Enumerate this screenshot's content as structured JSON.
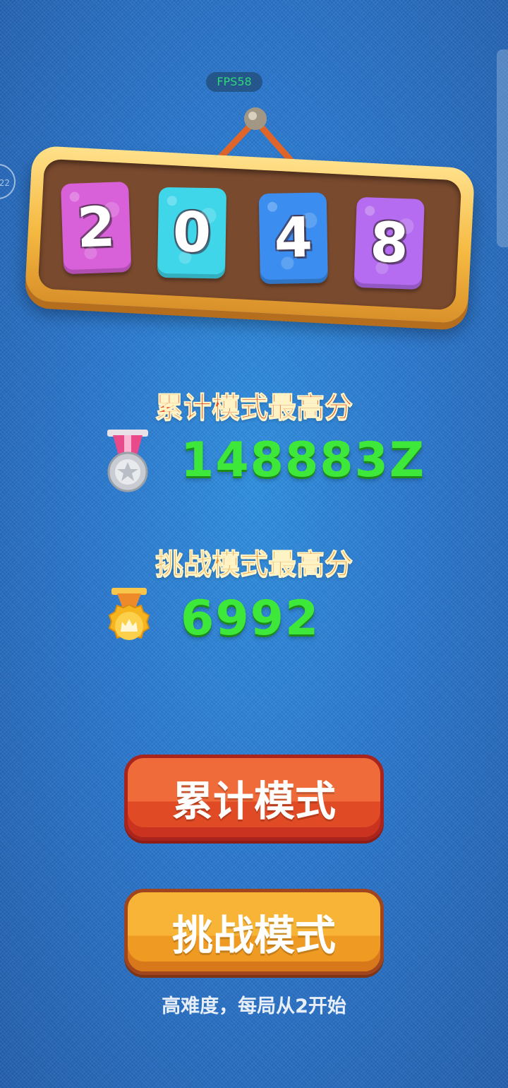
{
  "hud": {
    "fps": "FPS58",
    "side_bubble": "22"
  },
  "logo": {
    "tiles": [
      "2",
      "0",
      "4",
      "8"
    ]
  },
  "cumulative": {
    "label": "累计模式最高分",
    "score": "148883Z"
  },
  "challenge": {
    "label": "挑战模式最高分",
    "score": "6992"
  },
  "buttons": {
    "cumulative": "累计模式",
    "challenge": "挑战模式"
  },
  "hint": "高难度，每局从2开始",
  "colors": {
    "background": "#2a78cf",
    "score_green": "#3ee83a",
    "label_red": "#e0441f",
    "label_orange": "#e6892a",
    "tile_pink": "#d860d8",
    "tile_cyan": "#3fd6ea",
    "tile_blue": "#3b8ef0",
    "tile_purple": "#b56cf0"
  }
}
